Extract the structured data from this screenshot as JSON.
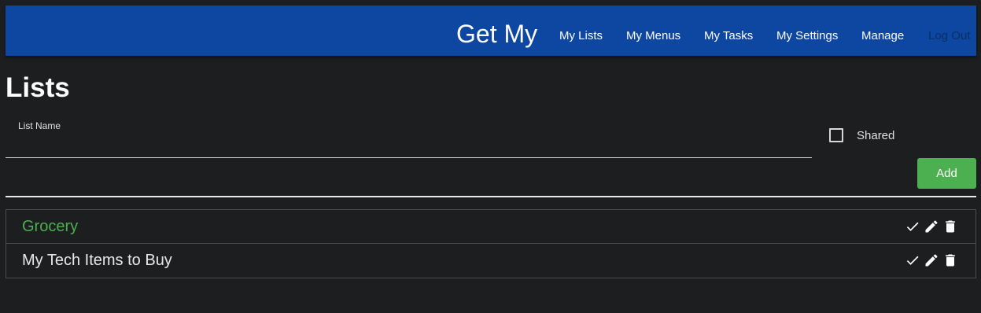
{
  "navbar": {
    "brand": "Get My",
    "links": [
      {
        "label": "My Lists"
      },
      {
        "label": "My Menus"
      },
      {
        "label": "My Tasks"
      },
      {
        "label": "My Settings"
      },
      {
        "label": "Manage"
      },
      {
        "label": "Log Out"
      }
    ]
  },
  "page": {
    "title": "Lists"
  },
  "form": {
    "list_name_label": "List Name",
    "list_name_value": "",
    "shared_label": "Shared",
    "shared_checked": false,
    "add_label": "Add"
  },
  "lists": [
    {
      "name": "Grocery",
      "active": true
    },
    {
      "name": "My Tech Items to Buy",
      "active": false
    }
  ],
  "colors": {
    "navbar": "#0d47a1",
    "accent": "#4caf50",
    "background": "#1d1e20"
  },
  "icons": {
    "complete": "check-icon",
    "edit": "pencil-icon",
    "delete": "trash-icon"
  }
}
